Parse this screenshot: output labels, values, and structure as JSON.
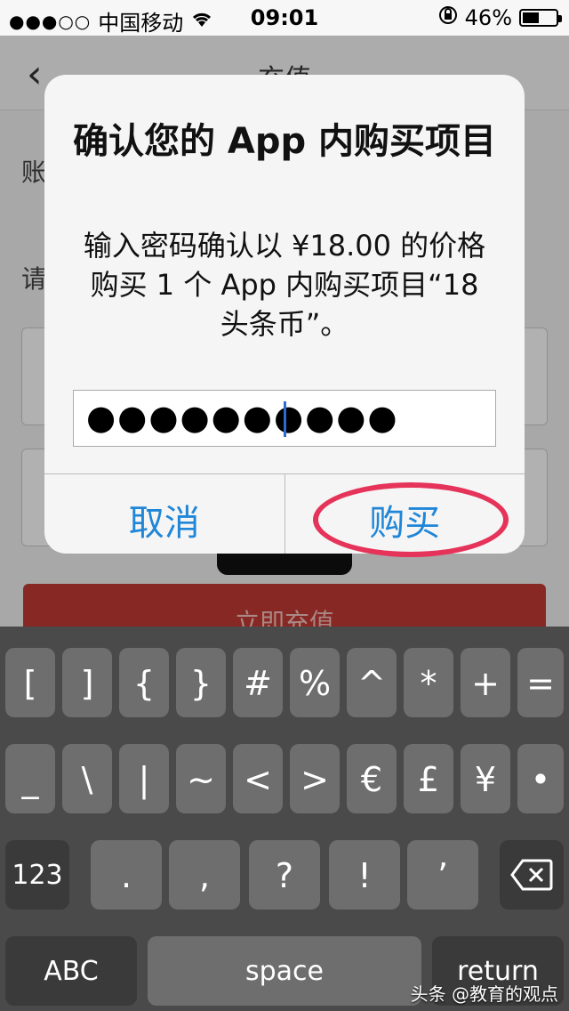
{
  "status_bar": {
    "signal": "●●●○○",
    "carrier": "中国移动",
    "time": "09:01",
    "battery_text": "46%",
    "battery_level": 0.46
  },
  "background_app": {
    "back_icon": "chevron-left-icon",
    "title": "充值",
    "label_account": "账",
    "label_amount": "请",
    "submit_label": "立即充值"
  },
  "dialog": {
    "title": "确认您的 App 内购买项目",
    "message": "输入密码确认以 ¥18.00 的价格购买 1 个 App 内购买项目“18头条币”。",
    "password_masked": "●●●●●●●●●●",
    "cancel_label": "取消",
    "buy_label": "购买",
    "accent_color": "#1f86d8",
    "highlight_color": "#e5335a"
  },
  "keyboard": {
    "row1": [
      "[",
      "]",
      "{",
      "}",
      "#",
      "%",
      "^",
      "*",
      "+",
      "="
    ],
    "row2": [
      "_",
      "\\",
      "|",
      "~",
      "<",
      ">",
      "€",
      "£",
      "¥",
      "•"
    ],
    "row3_left": "123",
    "row3": [
      ".",
      ",",
      "?",
      "!",
      "’"
    ],
    "delete_icon": "backspace-icon",
    "abc_label": "ABC",
    "space_label": "space",
    "return_label": "return"
  },
  "watermark": "头条 @教育的观点"
}
